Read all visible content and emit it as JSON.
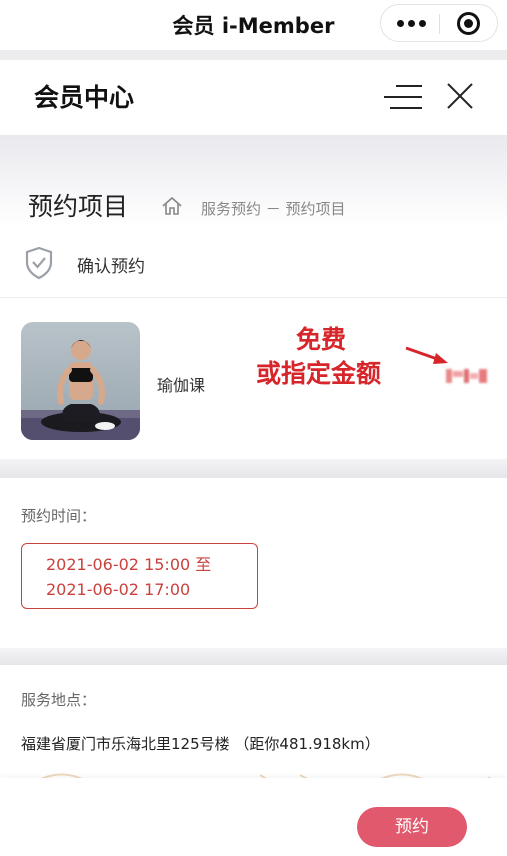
{
  "miniapp": {
    "title": "会员 i-Member"
  },
  "header": {
    "title": "会员中心"
  },
  "breadcrumb": {
    "page_title": "预约项目",
    "path": "服务预约 － 预约项目"
  },
  "confirm": {
    "label": "确认预约"
  },
  "item": {
    "name": "瑜伽课",
    "annotation_line1": "免费",
    "annotation_line2": "或指定金额"
  },
  "time": {
    "label": "预约时间：",
    "start": "2021-06-02 15:00 至",
    "end": "2021-06-02 17:00"
  },
  "location": {
    "label": "服务地点：",
    "address": "福建省厦门市乐海北里125号楼 （距你481.918km）"
  },
  "actions": {
    "book_label": "预约"
  },
  "colors": {
    "accent": "#e0596c",
    "time_border": "#c9423d",
    "annotation": "#d7262b"
  }
}
